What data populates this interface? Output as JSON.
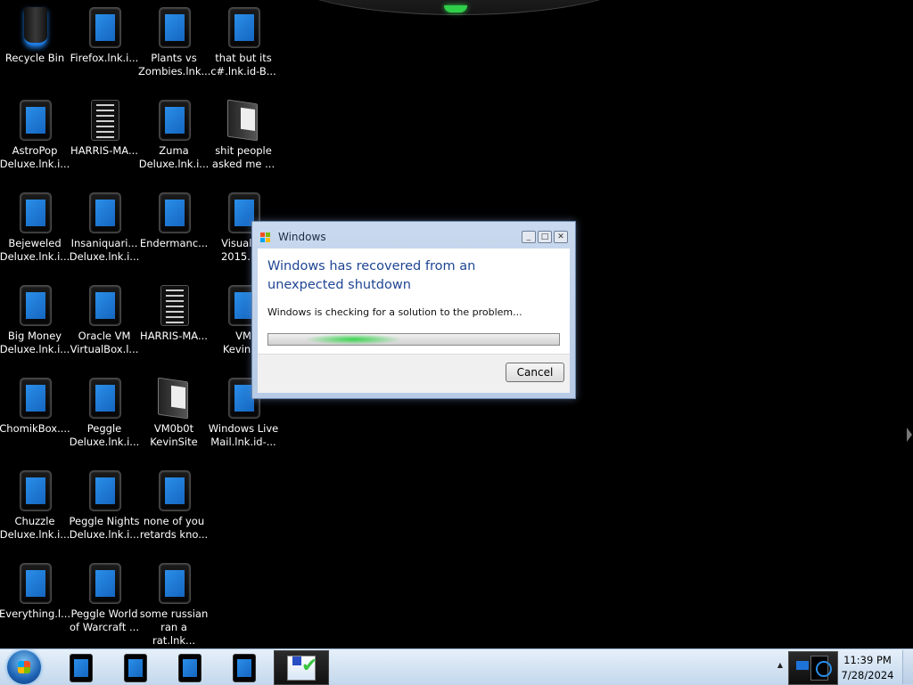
{
  "desktop": {
    "icons": [
      {
        "label": "Recycle Bin",
        "kind": "bin"
      },
      {
        "label": "Firefox.lnk.i...",
        "kind": "tablet"
      },
      {
        "label": "Plants vs\nZombies.lnk...",
        "kind": "tablet"
      },
      {
        "label": "that but its\nc#.lnk.id-B...",
        "kind": "tablet"
      },
      {
        "label": "AstroPop\nDeluxe.lnk.i...",
        "kind": "tablet"
      },
      {
        "label": "HARRIS-MA...",
        "kind": "doc"
      },
      {
        "label": "Zuma\nDeluxe.lnk.i...",
        "kind": "tablet"
      },
      {
        "label": "shit people\nasked me ...",
        "kind": "folder"
      },
      {
        "label": "Bejeweled\nDeluxe.lnk.i...",
        "kind": "tablet"
      },
      {
        "label": "Insaniquari...\nDeluxe.lnk.i...",
        "kind": "tablet"
      },
      {
        "label": "Endermanc...",
        "kind": "tablet"
      },
      {
        "label": "Visual St\n2015.lnk",
        "kind": "tablet"
      },
      {
        "label": "Big Money\nDeluxe.lnk.i...",
        "kind": "tablet"
      },
      {
        "label": "Oracle VM\nVirtualBox.l...",
        "kind": "tablet"
      },
      {
        "label": "HARRIS-MA...",
        "kind": "doc"
      },
      {
        "label": "VM\nKevinSit",
        "kind": "tablet"
      },
      {
        "label": "ChomikBox....",
        "kind": "tablet"
      },
      {
        "label": "Peggle\nDeluxe.lnk.i...",
        "kind": "tablet"
      },
      {
        "label": "VM0b0t\nKevinSite",
        "kind": "folder"
      },
      {
        "label": "Windows Live\nMail.lnk.id-...",
        "kind": "tablet"
      },
      {
        "label": "Chuzzle\nDeluxe.lnk.i...",
        "kind": "tablet"
      },
      {
        "label": "Peggle Nights\nDeluxe.lnk.i...",
        "kind": "tablet"
      },
      {
        "label": "none of you\nretards kno...",
        "kind": "tablet"
      },
      {
        "label": "Everything.l...",
        "kind": "tablet"
      },
      {
        "label": "Peggle World\nof Warcraft ...",
        "kind": "tablet"
      },
      {
        "label": "some russian\nran a rat.lnk...",
        "kind": "tablet"
      }
    ]
  },
  "dialog": {
    "title": "Windows",
    "heading": "Windows has recovered from an unexpected shutdown",
    "message": "Windows is checking for a solution to the problem...",
    "cancel_label": "Cancel",
    "controls": {
      "minimize": "_",
      "maximize": "□",
      "close": "✕"
    },
    "accent_color": "#1f4593"
  },
  "taskbar": {
    "start_icon": "windows-orb-icon",
    "pinned": [
      "app-icon",
      "app-icon",
      "app-icon",
      "app-icon",
      "action-center-icon"
    ],
    "tray_arrow": "▲",
    "clock": {
      "time": "11:39 PM",
      "date": "7/28/2024"
    }
  }
}
